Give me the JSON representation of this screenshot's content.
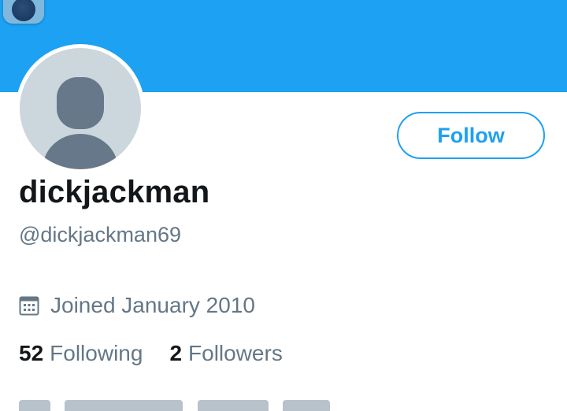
{
  "profile": {
    "display_name": "dickjackman",
    "handle": "@dickjackman69",
    "joined": "Joined January 2010",
    "follow_label": "Follow",
    "following_count": "52",
    "following_label": "Following",
    "followers_count": "2",
    "followers_label": "Followers"
  },
  "theme": {
    "banner_color": "#1da1f2",
    "accent": "#1da1f2",
    "text_primary": "#14171a",
    "text_secondary": "#657786",
    "avatar_bg": "#ccd6dd",
    "avatar_silhouette": "#67788a"
  },
  "icons": {
    "joined": "calendar-icon",
    "avatar": "default-user-silhouette-icon",
    "app_badge": "app-shortcut-icon"
  }
}
